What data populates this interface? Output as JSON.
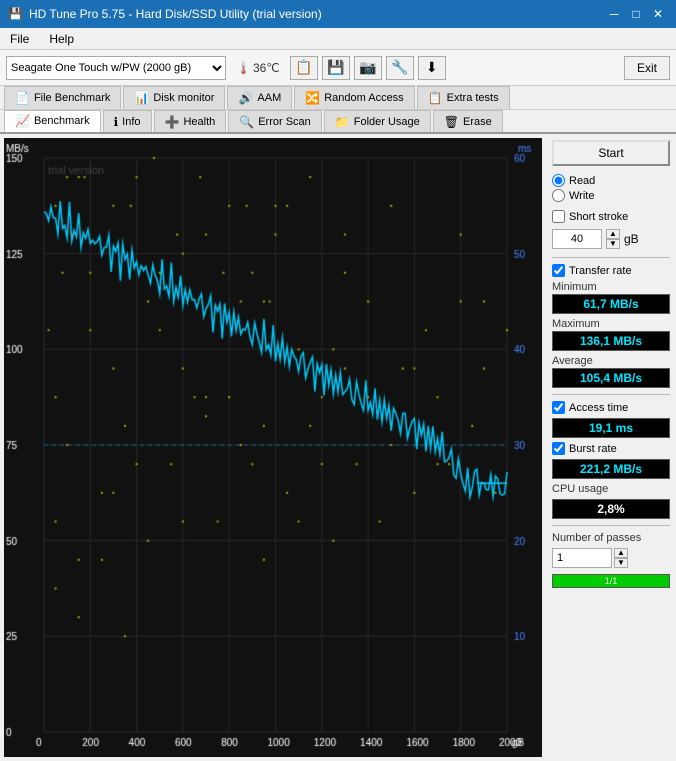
{
  "titlebar": {
    "title": "HD Tune Pro 5.75 - Hard Disk/SSD Utility (trial version)",
    "icon": "💾",
    "min_btn": "─",
    "max_btn": "□",
    "close_btn": "✕"
  },
  "menubar": {
    "items": [
      {
        "label": "File",
        "id": "file"
      },
      {
        "label": "Help",
        "id": "help"
      }
    ]
  },
  "toolbar": {
    "drive_select": "Seagate One Touch w/PW (2000 gB)",
    "drive_options": [
      "Seagate One Touch w/PW (2000 gB)"
    ],
    "temp": "36℃",
    "icons": [
      "📋",
      "📋",
      "📷",
      "🔧",
      "⬇"
    ],
    "exit_label": "Exit"
  },
  "tabs_top": [
    {
      "label": "File Benchmark",
      "icon": "📄",
      "active": false
    },
    {
      "label": "Disk monitor",
      "icon": "📊",
      "active": false
    },
    {
      "label": "AAM",
      "icon": "🔊",
      "active": false
    },
    {
      "label": "Random Access",
      "icon": "🔀",
      "active": false
    },
    {
      "label": "Extra tests",
      "icon": "📋",
      "active": false
    }
  ],
  "tabs_bottom": [
    {
      "label": "Benchmark",
      "icon": "📈",
      "active": true
    },
    {
      "label": "Info",
      "icon": "ℹ",
      "active": false
    },
    {
      "label": "Health",
      "icon": "➕",
      "active": false
    },
    {
      "label": "Error Scan",
      "icon": "🔍",
      "active": false
    },
    {
      "label": "Folder Usage",
      "icon": "📁",
      "active": false
    },
    {
      "label": "Erase",
      "icon": "🗑",
      "active": false
    }
  ],
  "chart": {
    "y_label": "MB/s",
    "y_right_label": "ms",
    "y_max": 150,
    "y_min": 0,
    "y_right_max": 60,
    "y_right_min": 0,
    "x_label": "gB",
    "x_max": 2000,
    "watermark": "trial version",
    "y_ticks": [
      0,
      25,
      50,
      75,
      100,
      125,
      150
    ],
    "x_ticks": [
      0,
      200,
      400,
      600,
      800,
      1000,
      1200,
      1400,
      1600,
      1800,
      2000
    ],
    "y_right_ticks": [
      10,
      20,
      30,
      40,
      50,
      60
    ]
  },
  "right_panel": {
    "start_label": "Start",
    "read_label": "Read",
    "write_label": "Write",
    "short_stroke_label": "Short stroke",
    "short_stroke_value": "40",
    "short_stroke_unit": "gB",
    "transfer_rate_label": "Transfer rate",
    "transfer_rate_checked": true,
    "minimum_label": "Minimum",
    "minimum_value": "61,7 MB/s",
    "maximum_label": "Maximum",
    "maximum_value": "136,1 MB/s",
    "average_label": "Average",
    "average_value": "105,4 MB/s",
    "access_time_label": "Access time",
    "access_time_checked": true,
    "access_time_value": "19,1 ms",
    "burst_rate_label": "Burst rate",
    "burst_rate_checked": true,
    "burst_rate_value": "221,2 MB/s",
    "cpu_usage_label": "CPU usage",
    "cpu_usage_value": "2,8%",
    "passes_label": "Number of passes",
    "passes_value": "1",
    "progress_value": "1/1",
    "progress_pct": 100
  }
}
